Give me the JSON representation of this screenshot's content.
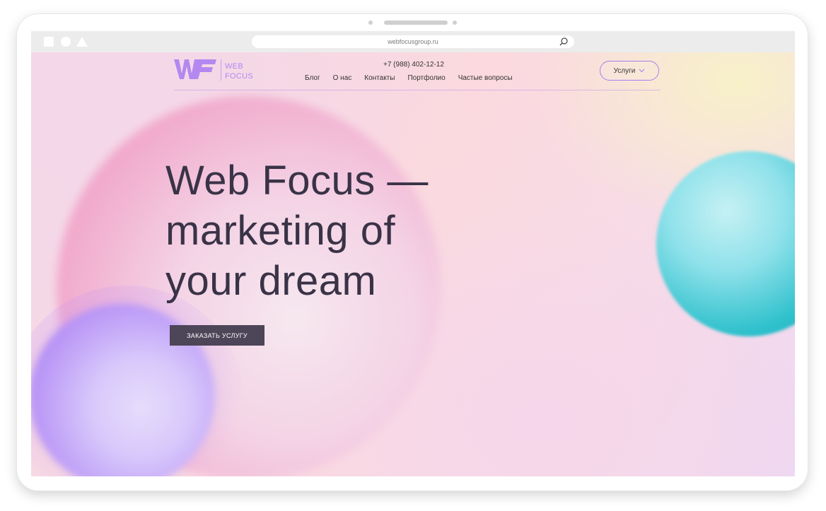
{
  "browser": {
    "url": "webfocusgroup.ru"
  },
  "header": {
    "logo_line1": "WEB",
    "logo_line2": "FOCUS",
    "phone": "+7 (988) 402-12-12",
    "nav": [
      "Блог",
      "О нас",
      "Контакты",
      "Портфолио",
      "Частые вопросы"
    ],
    "services_label": "Услуги"
  },
  "hero": {
    "title_lines": [
      "Web Focus —",
      "marketing of",
      "your dream"
    ],
    "cta_label": "ЗАКАЗАТЬ УСЛУГУ"
  },
  "colors": {
    "accent_violet": "#a77ef0",
    "logo": "#b488f0",
    "cta_bg": "#4d4558",
    "title_text": "#3a3347",
    "orb_teal": "#2fc1cc",
    "orb_pink": "#f1a9cc"
  },
  "icons": {
    "url_search": "search-icon",
    "services_chevron": "chevron-down-icon"
  }
}
